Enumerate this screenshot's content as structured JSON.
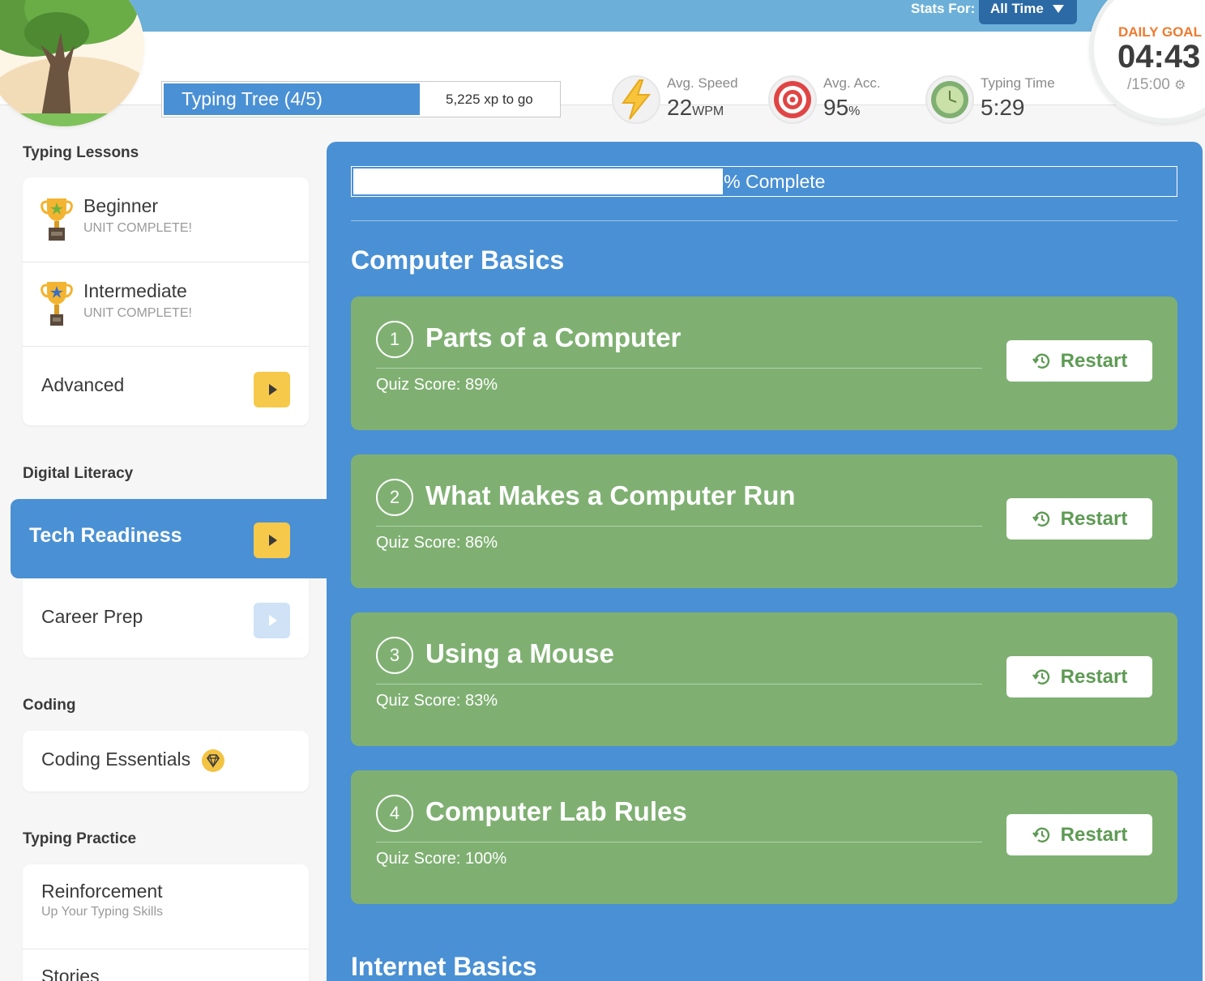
{
  "stats_bar": {
    "stats_for_label": "Stats For:",
    "range_selected": "All Time"
  },
  "tree": {
    "level_label": "Typing Tree (4/5)",
    "xp_to_go": "5,225 xp to go"
  },
  "stats": [
    {
      "label": "Avg. Speed",
      "value": "22",
      "unit": "WPM",
      "icon": "lightning-icon"
    },
    {
      "label": "Avg. Acc.",
      "value": "95",
      "unit": "%",
      "icon": "target-icon"
    },
    {
      "label": "Typing Time",
      "value": "5:29",
      "unit": "",
      "icon": "clock-icon"
    }
  ],
  "daily_goal": {
    "label": "DAILY GOAL",
    "time": "04:43",
    "total": "/15:00"
  },
  "sidebar": {
    "typing_lessons": {
      "title": "Typing Lessons",
      "items": [
        {
          "label": "Beginner",
          "status": "UNIT COMPLETE!",
          "icon": "trophy-icon"
        },
        {
          "label": "Intermediate",
          "status": "UNIT COMPLETE!",
          "icon": "trophy-icon"
        },
        {
          "label": "Advanced"
        }
      ]
    },
    "digital_literacy": {
      "title": "Digital Literacy",
      "items": [
        {
          "label": "Tech Readiness"
        },
        {
          "label": "Career Prep"
        }
      ]
    },
    "coding": {
      "title": "Coding",
      "items": [
        {
          "label": "Coding Essentials",
          "icon": "gem-icon"
        }
      ]
    },
    "typing_practice": {
      "title": "Typing Practice",
      "items": [
        {
          "label": "Reinforcement",
          "sub": "Up Your Typing Skills"
        },
        {
          "label": "Stories"
        }
      ]
    }
  },
  "main": {
    "progress": {
      "percent": 45,
      "label": "45% Complete"
    },
    "units": [
      {
        "title": "Computer Basics",
        "lessons": [
          {
            "number": "1",
            "title": "Parts of a Computer",
            "score": "Quiz Score: 89%",
            "action": "Restart"
          },
          {
            "number": "2",
            "title": "What Makes a Computer Run",
            "score": "Quiz Score: 86%",
            "action": "Restart"
          },
          {
            "number": "3",
            "title": "Using a Mouse",
            "score": "Quiz Score: 83%",
            "action": "Restart"
          },
          {
            "number": "4",
            "title": "Computer Lab Rules",
            "score": "Quiz Score: 100%",
            "action": "Restart"
          }
        ]
      },
      {
        "title": "Internet Basics"
      }
    ]
  },
  "colors": {
    "primary_blue": "#4a90d4",
    "topbar_blue": "#6cb0d9",
    "lesson_green": "#7fb072",
    "accent_yellow": "#f7c94a",
    "goal_orange": "#ef7a2e"
  }
}
